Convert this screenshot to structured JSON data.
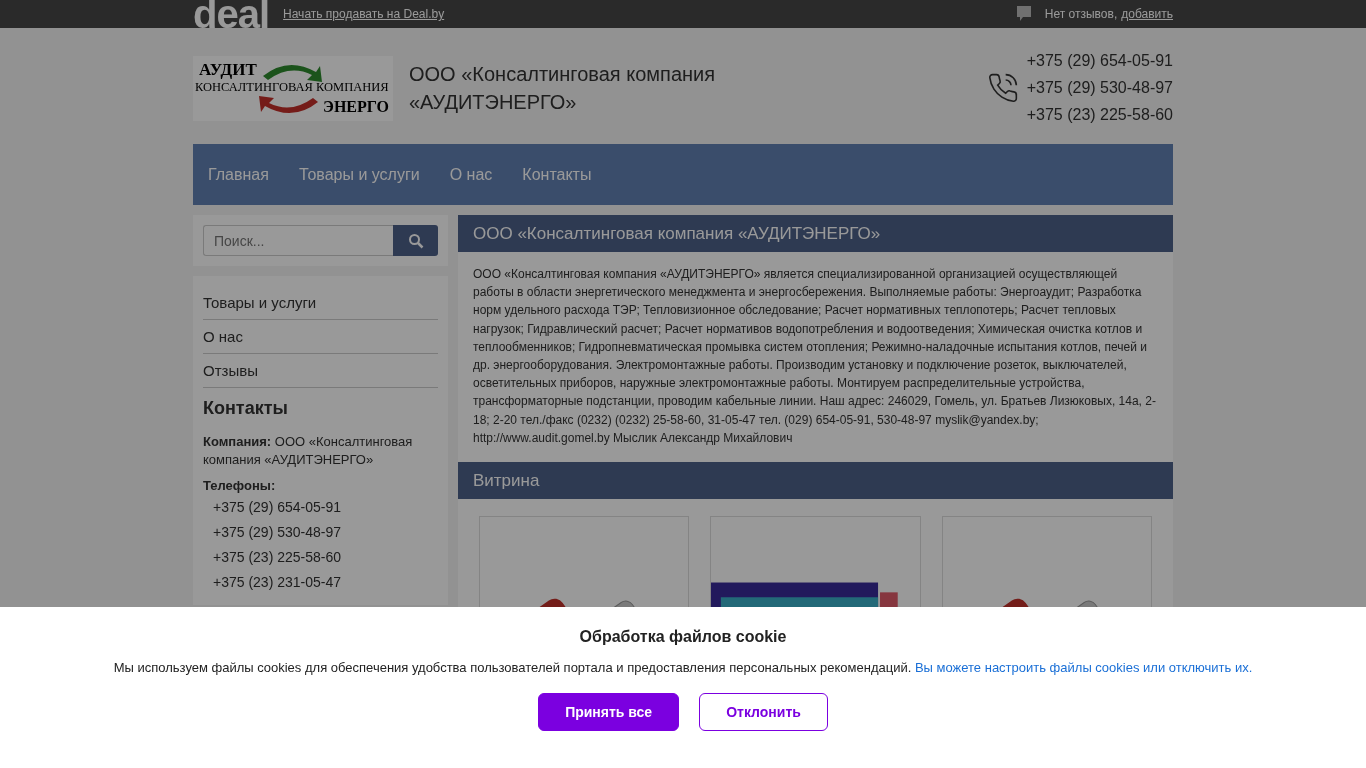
{
  "topbar": {
    "logo": "deal",
    "sell_link": "Начать продавать на Deal.by",
    "reviews_text": "Нет отзывов,",
    "reviews_link": "добавить"
  },
  "header": {
    "logo": {
      "line1": "АУДИТ",
      "line2": "КОНСАЛТИНГОВАЯ КОМПАНИЯ",
      "line3": "ЭНЕРГО"
    },
    "company_name": "ООО «Консалтинговая компания «АУДИТЭНЕРГО»",
    "phones": [
      "+375 (29) 654-05-91",
      "+375 (29) 530-48-97",
      "+375 (23) 225-58-60"
    ]
  },
  "nav": [
    "Главная",
    "Товары и услуги",
    "О нас",
    "Контакты"
  ],
  "sidebar": {
    "search": {
      "placeholder": "Поиск..."
    },
    "menu": [
      "Товары и услуги",
      "О нас",
      "Отзывы"
    ],
    "contacts": {
      "title": "Контакты",
      "company_label": "Компания:",
      "company": "ООО «Консалтинговая компания «АУДИТЭНЕРГО»",
      "phones_label": "Телефоны:",
      "phones": [
        "+375 (29) 654-05-91",
        "+375 (29) 530-48-97",
        "+375 (23) 225-58-60",
        "+375 (23) 231-05-47"
      ]
    }
  },
  "about": {
    "title": "ООО «Консалтинговая компания «АУДИТЭНЕРГО»",
    "text": "ООО «Консалтинговая компания «АУДИТЭНЕРГО» является специализированной организацией осуществляющей работы в области энергетического менеджмента и энергосбережения. Выполняемые работы: Энергоаудит; Разработка норм удельного расхода ТЭР; Тепловизионное обследование; Расчет нормативных теплопотерь; Расчет тепловых нагрузок; Гидравлический расчет; Расчет нормативов водопотребления и водоотведения; Химическая очистка котлов и теплообменников; Гидропневматическая промывка систем отопления; Режимно-наладочные испытания котлов, печей и др. энергооборудования. Электромонтажные работы. Производим установку и подключение розеток, выключателей, осветительных приборов, наружные электромонтажные работы. Монтируем распределительные устройства, трансформаторные подстанции, проводим кабельные линии. Наш адрес: 246029, Гомель, ул. Братьев Лизюковых, 14а, 2-18; 2-20 тел./факс (0232) (0232) 25-58-60, 31-05-47 тел. (029) 654-05-91, 530-48-97 myslik@yandex.by; http://www.audit.gomel.by Мыслик Александр Михайлович"
  },
  "showcase": {
    "title": "Витрина",
    "items": [
      {
        "kind": "tool"
      },
      {
        "kind": "thermal"
      },
      {
        "kind": "tool"
      }
    ]
  },
  "cookie": {
    "title": "Обработка файлов cookie",
    "text": "Мы используем файлы cookies для обеспечения удобства пользователей портала и предоставления персональных рекомендаций.",
    "link": "Вы можете настроить файлы cookies или отключить их.",
    "accept": "Принять все",
    "decline": "Отклонить"
  }
}
